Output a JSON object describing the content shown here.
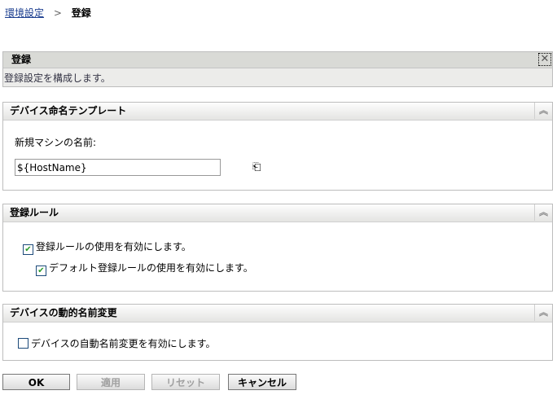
{
  "breadcrumb": {
    "parent": "環境設定",
    "separator": ">",
    "current": "登録"
  },
  "info": {
    "title": "登録",
    "description": "登録設定を構成します。"
  },
  "sections": {
    "naming": {
      "title": "デバイス命名テンプレート",
      "label": "新規マシンの名前:",
      "value": "${HostName}"
    },
    "rules": {
      "title": "登録ルール",
      "enable_rules": "登録ルールの使用を有効にします。",
      "enable_rules_checked": true,
      "enable_default": "デフォルト登録ルールの使用を有効にします。",
      "enable_default_checked": true
    },
    "rename": {
      "title": "デバイスの動的名前変更",
      "enable_rename": "デバイスの自動名前変更を有効にします。",
      "enable_rename_checked": false
    }
  },
  "buttons": {
    "ok": "OK",
    "apply": "適用",
    "reset": "リセット",
    "cancel": "キャンセル"
  }
}
